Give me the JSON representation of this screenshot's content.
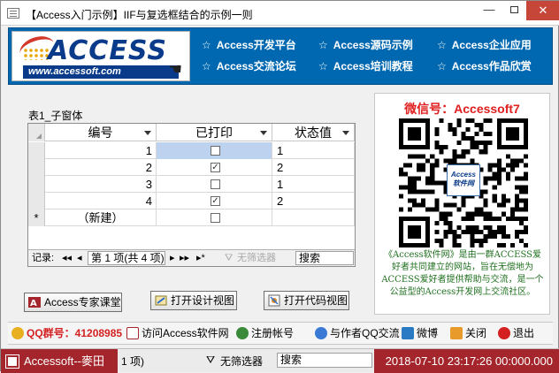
{
  "window": {
    "title": "【Access入门示例】IIF与复选框结合的示例一则",
    "controls": [
      "—",
      "□",
      "✕"
    ]
  },
  "banner": {
    "logo_text": "ACCESS",
    "logo_url": "www.accessoft.com",
    "links": [
      "Access开发平台",
      "Access源码示例",
      "Access企业应用",
      "Access交流论坛",
      "Access培训教程",
      "Access作品欣赏"
    ],
    "star": "☆"
  },
  "subform": {
    "label": "表1_子窗体",
    "columns": [
      "编号",
      "已打印",
      "状态值"
    ],
    "rows": [
      {
        "id": "1",
        "printed": false,
        "status": "1"
      },
      {
        "id": "2",
        "printed": true,
        "status": "2"
      },
      {
        "id": "3",
        "printed": false,
        "status": "1"
      },
      {
        "id": "4",
        "printed": true,
        "status": "2"
      }
    ],
    "new_row_label": "（新建）",
    "new_row_marker": "*",
    "nav": {
      "record_label": "记录:",
      "first": "◂◂",
      "prev": "◂",
      "position": "第 1 项(共 4 项)",
      "next": "▸",
      "last": "▸▸",
      "new": "▸*",
      "filter": "无筛选器",
      "search": "搜索"
    }
  },
  "panel": {
    "wechat": "微信号：Accessoft7",
    "qr_logo_line1": "Access",
    "qr_logo_line2": "软件网",
    "description": "《Access软件网》是由一群ACCESS爱好者共同建立的网站，旨在无偿地为ACCESS爱好者提供帮助与交流，是一个公益型的Access开发网上交流社区。"
  },
  "buttons": {
    "expert_class": "Access专家课堂",
    "open_design": "打开设计视图",
    "open_code": "打开代码视图"
  },
  "footer": {
    "qq_group": "QQ群号：41208985",
    "visit_site": "访问Access软件网",
    "register": "注册帐号",
    "chat_author": "与作者QQ交流",
    "weibo": "微博",
    "close": "关闭",
    "exit": "退出"
  },
  "taskbar": {
    "app_label": "Accessoft--麥田",
    "record_fragment": "1 项)",
    "filter": "无筛选器",
    "search": "搜索",
    "datetime": "2018-07-10 23:17:26 00:000.000"
  },
  "colors": {
    "banner_blue": "#0068b0",
    "accent_red": "#a4262c",
    "wechat_red": "#e02020",
    "desc_green": "#207020",
    "selected_cell": "#bcd2ee"
  }
}
